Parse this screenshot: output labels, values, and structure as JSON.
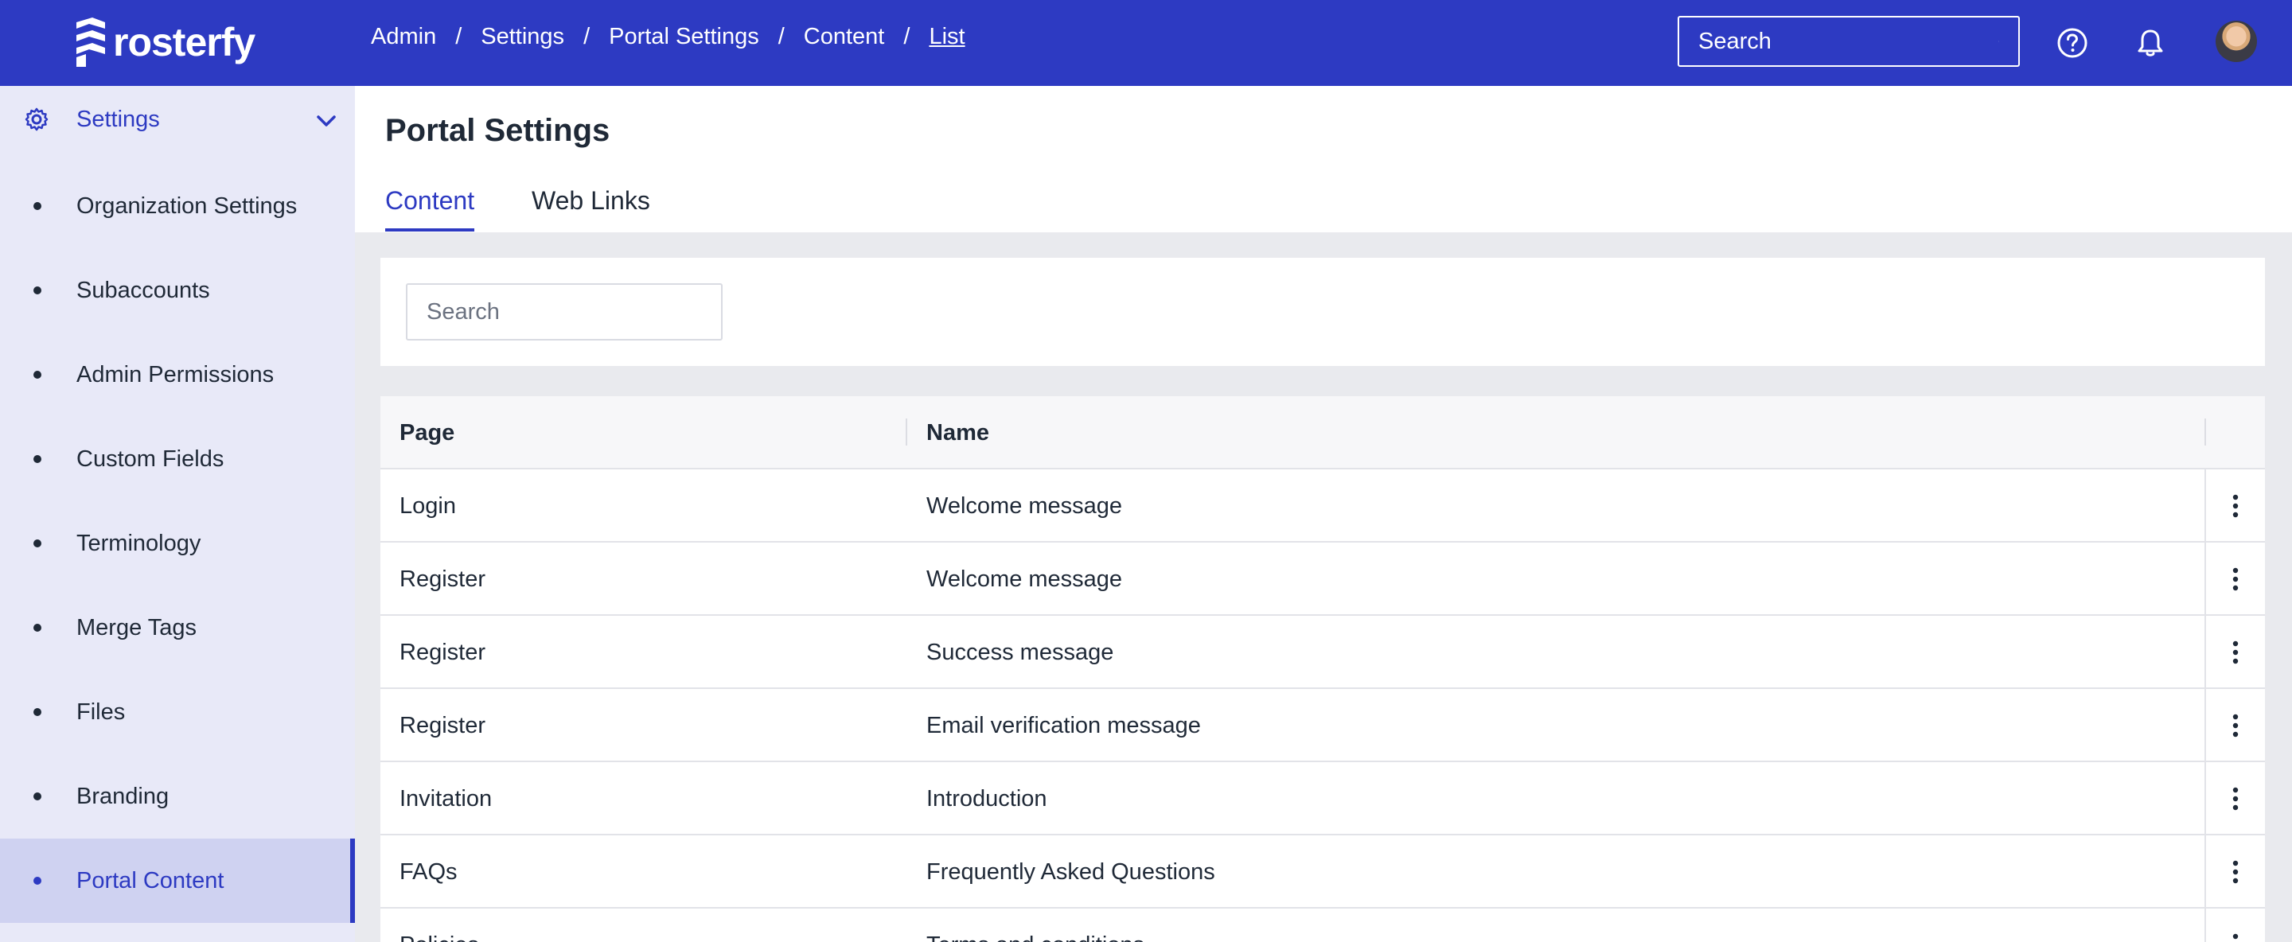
{
  "app": {
    "brand": "rosterfy",
    "accent": "#2d3ac2"
  },
  "breadcrumb": [
    "Admin",
    "Settings",
    "Portal Settings",
    "Content",
    "List"
  ],
  "header": {
    "search_placeholder": "Search"
  },
  "sidebar": {
    "section_title": "Settings",
    "items": [
      {
        "label": "Organization Settings"
      },
      {
        "label": "Subaccounts"
      },
      {
        "label": "Admin Permissions"
      },
      {
        "label": "Custom Fields"
      },
      {
        "label": "Terminology"
      },
      {
        "label": "Merge Tags"
      },
      {
        "label": "Files"
      },
      {
        "label": "Branding"
      },
      {
        "label": "Portal Content"
      }
    ],
    "active_item": "Portal Content"
  },
  "main": {
    "title": "Portal Settings",
    "tabs": [
      {
        "label": "Content"
      },
      {
        "label": "Web Links"
      }
    ],
    "active_tab": "Content",
    "search_placeholder": "Search",
    "table": {
      "columns": [
        "Page",
        "Name"
      ],
      "rows": [
        {
          "page": "Login",
          "name": "Welcome message"
        },
        {
          "page": "Register",
          "name": "Welcome message"
        },
        {
          "page": "Register",
          "name": "Success message"
        },
        {
          "page": "Register",
          "name": "Email verification message"
        },
        {
          "page": "Invitation",
          "name": "Introduction"
        },
        {
          "page": "FAQs",
          "name": "Frequently Asked Questions"
        },
        {
          "page": "Policies",
          "name": "Terms and conditions"
        }
      ]
    }
  }
}
